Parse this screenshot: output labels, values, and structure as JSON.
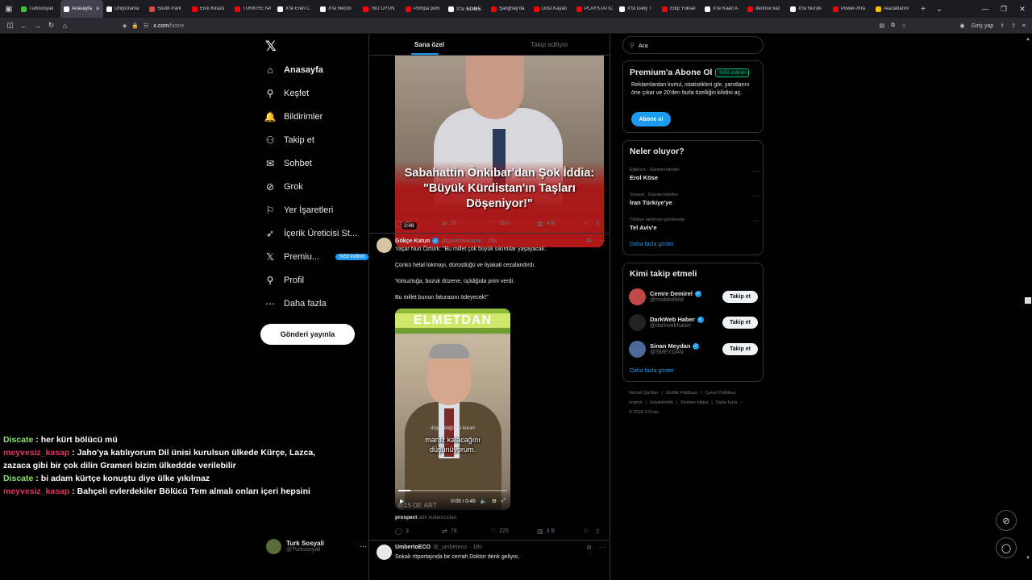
{
  "browser": {
    "tabs": [
      {
        "title": "Turksosyali",
        "color": "#3fbf3f"
      },
      {
        "title": "Anasayfa",
        "color": "#ffffff",
        "active": true
      },
      {
        "title": "OnlyDrama",
        "color": "#ffffff"
      },
      {
        "title": "South Park",
        "color": "#e0483c"
      },
      {
        "title": "Enis Kirazo",
        "color": "#ff0000"
      },
      {
        "title": "TÜRKİYE NA",
        "color": "#ff0000"
      },
      {
        "title": "X'te Eren C",
        "color": "#ffffff"
      },
      {
        "title": "X'te Necmi",
        "color": "#ffffff"
      },
      {
        "title": "\"BU OYUN",
        "color": "#ff0000"
      },
      {
        "title": "Pompa pom",
        "color": "#ff0000"
      },
      {
        "title": "X'te 𝗦𝗢𝗡𝗦",
        "color": "#ffffff"
      },
      {
        "title": "Şanghay'da",
        "color": "#ff0000"
      },
      {
        "title": "Dost Kayao",
        "color": "#ff0000"
      },
      {
        "title": "PLAYSTATIC",
        "color": "#ff0000"
      },
      {
        "title": "X'te Daily T",
        "color": "#ffffff"
      },
      {
        "title": "Edip Yüksel",
        "color": "#ff0000"
      },
      {
        "title": "X'te Kaan A",
        "color": "#ffffff"
      },
      {
        "title": "derince kaz",
        "color": "#ff0000"
      },
      {
        "title": "X'te Nurulli",
        "color": "#ffffff"
      },
      {
        "title": "Power-Xtra",
        "color": "#ff0000"
      },
      {
        "title": "Alacaklarını",
        "color": "#f2c200"
      }
    ],
    "url_domain": "x.com",
    "url_path": "/home",
    "login_label": "Giriş yap"
  },
  "sidebar": {
    "items": [
      {
        "label": "Anasayfa",
        "icon": "home-icon",
        "glyph": "⌂"
      },
      {
        "label": "Keşfet",
        "icon": "search-icon",
        "glyph": "⚲"
      },
      {
        "label": "Bildirimler",
        "icon": "bell-icon",
        "glyph": "🔔"
      },
      {
        "label": "Takip et",
        "icon": "follow-icon",
        "glyph": "⚇"
      },
      {
        "label": "Sohbet",
        "icon": "mail-icon",
        "glyph": "✉"
      },
      {
        "label": "Grok",
        "icon": "grok-icon",
        "glyph": "⊘"
      },
      {
        "label": "Yer İşaretleri",
        "icon": "bookmark-icon",
        "glyph": "⚐"
      },
      {
        "label": "İçerik Üreticisi St...",
        "icon": "rocket-icon",
        "glyph": "➶"
      },
      {
        "label": "Premiu...",
        "icon": "x-premium-icon",
        "glyph": "𝕏",
        "badge": "%50 indirim"
      },
      {
        "label": "Profil",
        "icon": "profile-icon",
        "glyph": "⚲"
      },
      {
        "label": "Daha fazla",
        "icon": "more-icon",
        "glyph": "⋯"
      }
    ],
    "post_button": "Gönderi yayınla",
    "profile_name": "Turk Sosyali",
    "profile_handle": "@Turksosyali"
  },
  "chat": [
    {
      "user": "Discate",
      "color": "#8fe36b",
      "text": " : her kürt bölücü mü"
    },
    {
      "user": "meyvesiz_kasap",
      "color": "#e0345a",
      "text": " : Jaho'ya katılıyorum Dil ünisi kurulsun ülkede Kürçe, Lazca,"
    },
    {
      "user": "",
      "color": "#ffffff",
      "text": "zazaca gibi bir çok dilin Grameri bizim ülkeddde verilebilir"
    },
    {
      "user": "Discate",
      "color": "#8fe36b",
      "text": " : bi adam kürtçe konuştu diye ülke yıkılmaz"
    },
    {
      "user": "meyvesiz_kasap",
      "color": "#e0345a",
      "text": " : Bahçeli evlerdekiler Bölücü Tem almalı onları içeri hepsini"
    }
  ],
  "timeline": {
    "tabs": [
      "Sana özel",
      "Takip ediliyor"
    ],
    "tweet1": {
      "video_caption_line1": "Sabahattin Önkibar'dan Şok İddia:",
      "video_caption_line2": "\"Büyük Kürdistan'ın Taşları",
      "video_caption_line3": "Döşeniyor!\"",
      "duration": "3:48",
      "replies": "31",
      "retweets": "30",
      "likes": "150",
      "views": "4 B"
    },
    "tweet2": {
      "name": "Gökçe Katun",
      "handle": "@gokkceekatun",
      "time": "· 19s",
      "lines": [
        "Yaşar Nuri Öztürk: \"Bu millet çok büyük sıkıntılar yaşayacak.",
        "Çünkü helal lokmayı, dürüstlüğü ve liyakati cezalandırdı.",
        "Yolsuzluğa, bozuk düzene, üçkâğıda prim verdi.",
        "Bu millet bunun faturasını ödeyecek!\""
      ],
      "video_banner": "ELMETDAN",
      "subtitle_small": "düşündüğümü kuran",
      "subtitle_line1": "maruz kalacağını",
      "subtitle_line2": "düşünüyorum.",
      "watermark": "0:15 DE ART",
      "video_time": "0:05 / 0:45",
      "progress": 0.11,
      "source_user": "prospect",
      "source_suffix": " adlı kullanıcıdan",
      "replies": "3",
      "retweets": "79",
      "likes": "225",
      "views": "3 B"
    },
    "tweet3": {
      "name": "UmbertoECO",
      "handle": "@_umbereco",
      "time": "· 18s",
      "text": "Sokak röportajında bir cerrah Doktor denk geliyor,"
    }
  },
  "right": {
    "search_placeholder": "Ara",
    "premium_title": "Premium'a Abone Ol",
    "premium_badge": "%50 indirim",
    "premium_desc": "Reklamlardan kurtul, istatistikleri gör, yanıtlarını öne çıkar ve 20'den fazla özelliğin kilidini aç.",
    "subscribe_button": "Abone ol",
    "trends_title": "Neler oluyor?",
    "trends": [
      {
        "category": "Eğlence · Gündemdekiler",
        "title": "Erol Köse"
      },
      {
        "category": "Siyaset · Gündemdekiler",
        "title": "İran Türkiye'ye"
      },
      {
        "category": "Türkiye tarihinde gündemde",
        "title": "Tel Aviv'e"
      }
    ],
    "show_more": "Daha fazla göster",
    "who_title": "Kimi takip etmeli",
    "who": [
      {
        "name": "Cemre Demirel",
        "handle": "@msikkofield",
        "color": "#c04848"
      },
      {
        "name": "DarkWeb Haber",
        "handle": "@darkwebhaber",
        "color": "#222222"
      },
      {
        "name": "Sinan Meydan",
        "handle": "@SMEYDAN",
        "color": "#4a6a9a"
      }
    ],
    "follow_label": "Takip et",
    "footer_row1": [
      "Hizmet Şartları",
      "Gizlilik Politikası",
      "Çerez Politikası"
    ],
    "footer_row2": [
      "Imprint",
      "Erişilebilirlik",
      "Reklam bilgisi",
      "Daha fazla ···"
    ],
    "footer_copy": "© 2026 X Corp."
  }
}
